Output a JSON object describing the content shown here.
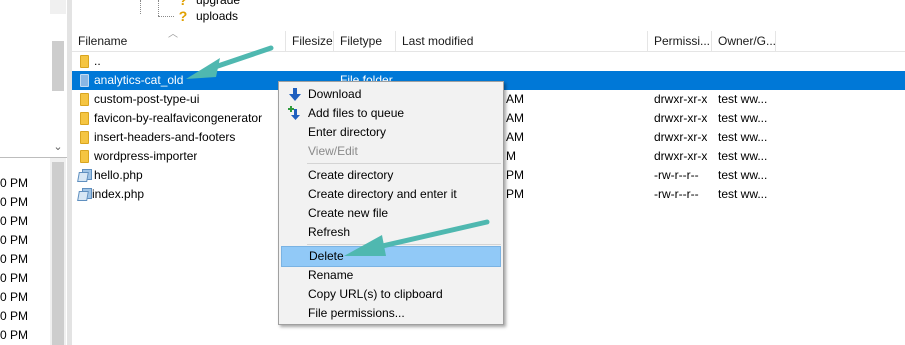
{
  "left_pane": {
    "times": [
      "0 PM",
      "0 PM",
      "0 PM",
      "0 PM",
      "0 PM",
      "0 PM",
      "0 PM",
      "0 PM",
      "0 PM"
    ]
  },
  "tree": {
    "items": [
      {
        "label": "upgrade",
        "icon": "unknown-folder-icon"
      },
      {
        "label": "uploads",
        "icon": "unknown-folder-icon"
      }
    ]
  },
  "columns": {
    "filename": "Filename",
    "filesize": "Filesize",
    "filetype": "Filetype",
    "last_modified": "Last modified",
    "permissions": "Permissi...",
    "owner": "Owner/G..."
  },
  "rows": [
    {
      "name": "..",
      "type": "",
      "modified": "",
      "perms": "",
      "owner": "",
      "icon": "folder-icon"
    },
    {
      "name": "analytics-cat_old",
      "type": "File folder",
      "modified": "",
      "perms": "",
      "owner": "",
      "icon": "folder-icon",
      "selected": true
    },
    {
      "name": "custom-post-type-ui",
      "type": "",
      "modified": "AM",
      "perms": "drwxr-xr-x",
      "owner": "test ww...",
      "icon": "folder-icon"
    },
    {
      "name": "favicon-by-realfavicongenerator",
      "type": "",
      "modified": "AM",
      "perms": "drwxr-xr-x",
      "owner": "test ww...",
      "icon": "folder-icon"
    },
    {
      "name": "insert-headers-and-footers",
      "type": "",
      "modified": "AM",
      "perms": "drwxr-xr-x",
      "owner": "test ww...",
      "icon": "folder-icon"
    },
    {
      "name": "wordpress-importer",
      "type": "",
      "modified": "M",
      "perms": "drwxr-xr-x",
      "owner": "test ww...",
      "icon": "folder-icon"
    },
    {
      "name": "hello.php",
      "type": "",
      "modified": "PM",
      "perms": "-rw-r--r--",
      "owner": "test ww...",
      "icon": "php-file-icon"
    },
    {
      "name": "index.php",
      "type": "",
      "modified": "PM",
      "perms": "-rw-r--r--",
      "owner": "test ww...",
      "icon": "php-file-icon"
    }
  ],
  "context_menu": {
    "download": "Download",
    "add_to_queue": "Add files to queue",
    "enter_directory": "Enter directory",
    "view_edit": "View/Edit",
    "create_directory": "Create directory",
    "create_directory_enter": "Create directory and enter it",
    "create_new_file": "Create new file",
    "refresh": "Refresh",
    "delete": "Delete",
    "rename": "Rename",
    "copy_urls": "Copy URL(s) to clipboard",
    "file_permissions": "File permissions..."
  },
  "colors": {
    "selection": "#0078d7",
    "menu_highlight": "#91c9f7",
    "annotation_arrow": "#4fb8b0",
    "folder": "#f5c542"
  }
}
